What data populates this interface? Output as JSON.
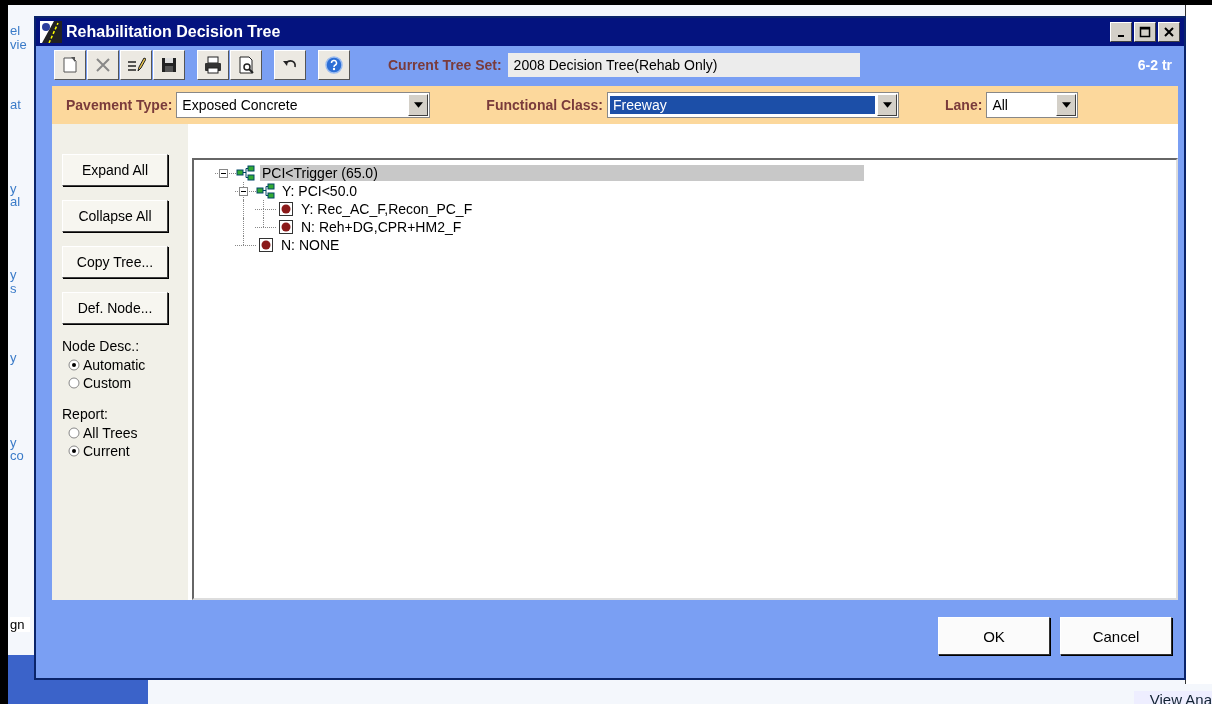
{
  "background_window": {
    "fragments": [
      "el",
      "vie",
      "at",
      "y",
      "al",
      "y",
      "s",
      "y",
      "y",
      "co",
      "gn"
    ],
    "bottom_right": "View Ana"
  },
  "window": {
    "title": "Rehabilitation Decision Tree"
  },
  "toolbar": {
    "current_tree_set_label": "Current Tree Set:",
    "current_tree_set": "2008 Decision Tree(Rehab Only)",
    "note": "6-2 tr"
  },
  "filters": [
    {
      "label": "Pavement Type:",
      "value": "Exposed Concrete",
      "focused": false
    },
    {
      "label": "Functional Class:",
      "value": "Freeway",
      "focused": true
    },
    {
      "label": "Lane:",
      "value": "All",
      "focused": false
    }
  ],
  "side_buttons": [
    "Expand All",
    "Collapse All",
    "Copy Tree...",
    "Def. Node..."
  ],
  "node_desc": {
    "label": "Node Desc.:",
    "options": [
      {
        "label": "Automatic",
        "selected": true
      },
      {
        "label": "Custom",
        "selected": false
      }
    ]
  },
  "report": {
    "label": "Report:",
    "options": [
      {
        "label": "All Trees",
        "selected": false
      },
      {
        "label": "Current",
        "selected": true
      }
    ]
  },
  "tree": [
    {
      "label": "PCI<Trigger (65.0)",
      "kind": "branch",
      "expanded": true,
      "selected": true,
      "children": [
        {
          "label": "Y: PCI<50.0",
          "kind": "branch",
          "expanded": true,
          "selected": false,
          "children": [
            {
              "label": "Y: Rec_AC_F,Recon_PC_F",
              "kind": "leaf",
              "selected": false
            },
            {
              "label": "N: Reh+DG,CPR+HM2_F",
              "kind": "leaf",
              "selected": false
            }
          ]
        },
        {
          "label": "N: NONE",
          "kind": "leaf",
          "selected": false
        }
      ]
    }
  ],
  "buttons": [
    "OK",
    "Cancel"
  ]
}
